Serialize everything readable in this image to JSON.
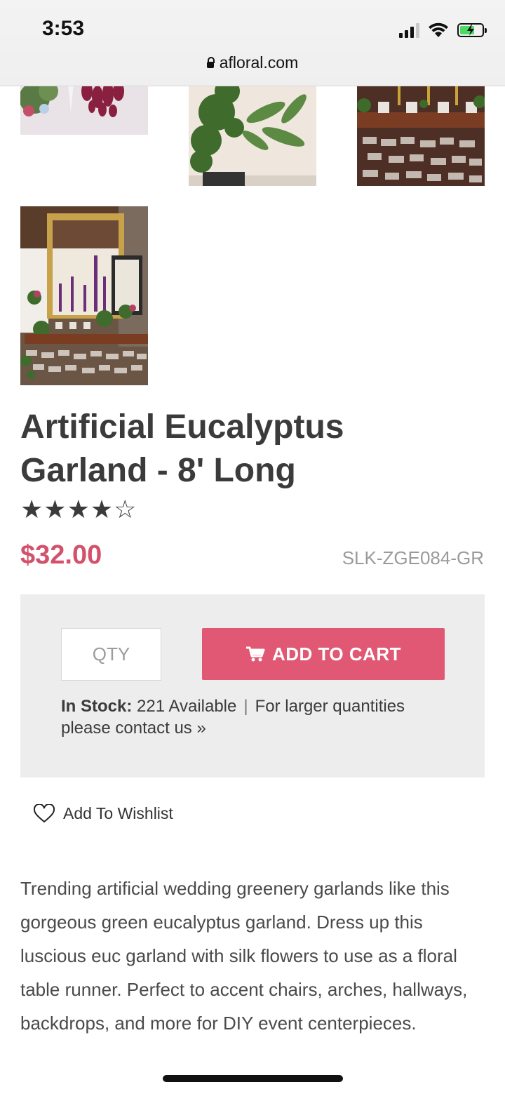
{
  "status_bar": {
    "time": "3:53"
  },
  "browser": {
    "url": "afloral.com"
  },
  "product": {
    "title": "Artificial Eucalyptus Garland - 8' Long",
    "rating": 4,
    "rating_max": 5,
    "stars": [
      "★",
      "★",
      "★",
      "★",
      "☆"
    ],
    "price": "$32.00",
    "sku": "SLK-ZGE084-GR"
  },
  "cart": {
    "qty_placeholder": "QTY",
    "add_to_cart_label": "ADD TO CART",
    "stock_label": "In Stock:",
    "stock_value": "221 Available",
    "separator": "|",
    "larger_qty_text": "For larger quantities",
    "contact_link": "please contact us »"
  },
  "wishlist": {
    "label": "Add To Wishlist"
  },
  "description": "Trending artificial wedding greenery garlands like this gorgeous green eucalyptus garland. Dress up this luscious euc garland with silk flowers to use as a floral table runner. Perfect to accent chairs, arches, hallways, backdrops, and more for DIY event centerpieces.",
  "colors": {
    "accent": "#e05873",
    "price": "#d3516b",
    "panel": "#ededed"
  },
  "icons": [
    "lock-icon",
    "cart-icon",
    "heart-icon",
    "signal-icon",
    "wifi-icon",
    "battery-icon"
  ]
}
